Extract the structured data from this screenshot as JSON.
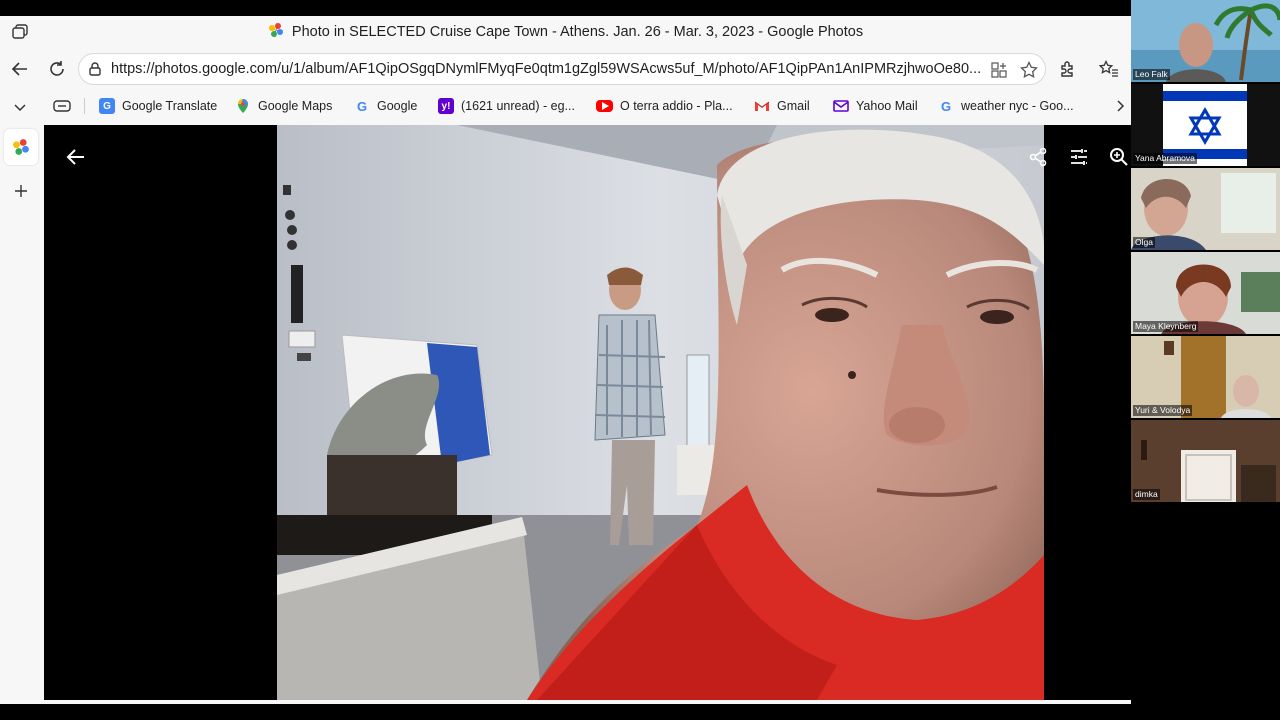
{
  "browser": {
    "title": "Photo in SELECTED Cruise Cape Town - Athens. Jan. 26 - Mar. 3, 2023 - Google Photos",
    "url": "https://photos.google.com/u/1/album/AF1QipOSgqDNymlFMyqFe0qtm1gZgl59WSAcws5uf_M/photo/AF1QipPAn1AnIPMRzjhwoOe80..."
  },
  "bookmarks": [
    {
      "label": "Google Translate",
      "icon": "translate-icon",
      "color": "#4285f4"
    },
    {
      "label": "Google Maps",
      "icon": "maps-pin-icon",
      "color": "#34a853"
    },
    {
      "label": "Google",
      "icon": "google-g-icon",
      "color": "#4285f4"
    },
    {
      "label": "(1621 unread) - eg...",
      "icon": "yahoo-icon",
      "color": "#6001d2"
    },
    {
      "label": "O terra addio - Pla...",
      "icon": "youtube-icon",
      "color": "#ff0000"
    },
    {
      "label": "Gmail",
      "icon": "gmail-icon",
      "color": "#ea4335"
    },
    {
      "label": "Yahoo Mail",
      "icon": "yahoo-mail-icon",
      "color": "#6001d2"
    },
    {
      "label": "weather nyc - Goo...",
      "icon": "google-g-icon",
      "color": "#4285f4"
    }
  ],
  "participants": [
    {
      "name": "Leo Falk"
    },
    {
      "name": "Yana Abramova"
    },
    {
      "name": "Olga"
    },
    {
      "name": "Maya Kleynberg"
    },
    {
      "name": "Yuri & Volodya"
    },
    {
      "name": "dimka"
    }
  ],
  "colors": {
    "accent": "#1a73e8",
    "shirt": "#d92a24",
    "flag_blue": "#0038b8"
  }
}
